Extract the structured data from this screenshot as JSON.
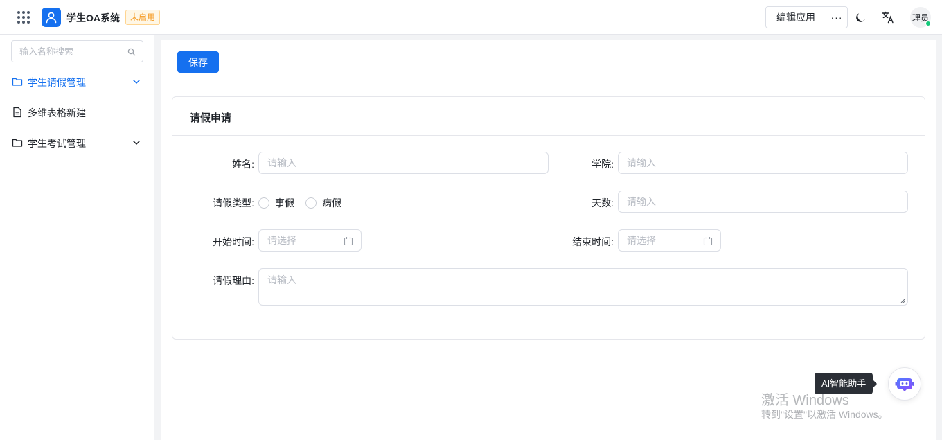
{
  "header": {
    "app_title": "学生OA系统",
    "status_badge": "未启用",
    "edit_app_label": "编辑应用",
    "more_label": "···",
    "avatar_text": "理员"
  },
  "sidebar": {
    "search_placeholder": "输入名称搜索",
    "items": [
      {
        "label": "学生请假管理",
        "icon": "folder-icon",
        "expandable": true,
        "active": true
      },
      {
        "label": "多维表格新建",
        "icon": "document-icon",
        "expandable": false,
        "active": false
      },
      {
        "label": "学生考试管理",
        "icon": "folder-icon",
        "expandable": true,
        "active": false
      }
    ]
  },
  "toolbar": {
    "save_label": "保存"
  },
  "form": {
    "title": "请假申请",
    "fields": {
      "name": {
        "label": "姓名:",
        "placeholder": "请输入",
        "value": ""
      },
      "college": {
        "label": "学院:",
        "placeholder": "请输入",
        "value": ""
      },
      "leave_type": {
        "label": "请假类型:",
        "options": [
          "事假",
          "病假"
        ],
        "selected": null
      },
      "days": {
        "label": "天数:",
        "placeholder": "请输入",
        "value": ""
      },
      "start_time": {
        "label": "开始时间:",
        "placeholder": "请选择",
        "value": ""
      },
      "end_time": {
        "label": "结束时间:",
        "placeholder": "请选择",
        "value": ""
      },
      "reason": {
        "label": "请假理由:",
        "placeholder": "请输入",
        "value": ""
      }
    }
  },
  "assistant": {
    "tooltip": "AI智能助手"
  },
  "watermark": {
    "line1": "激活 Windows",
    "line2": "转到\"设置\"以激活 Windows。"
  },
  "colors": {
    "primary": "#1570ef",
    "badge_text": "#f59a23",
    "badge_bg": "#fff7e6",
    "online_dot": "#14c97a",
    "assistant_icon": "#5b5ce6"
  }
}
